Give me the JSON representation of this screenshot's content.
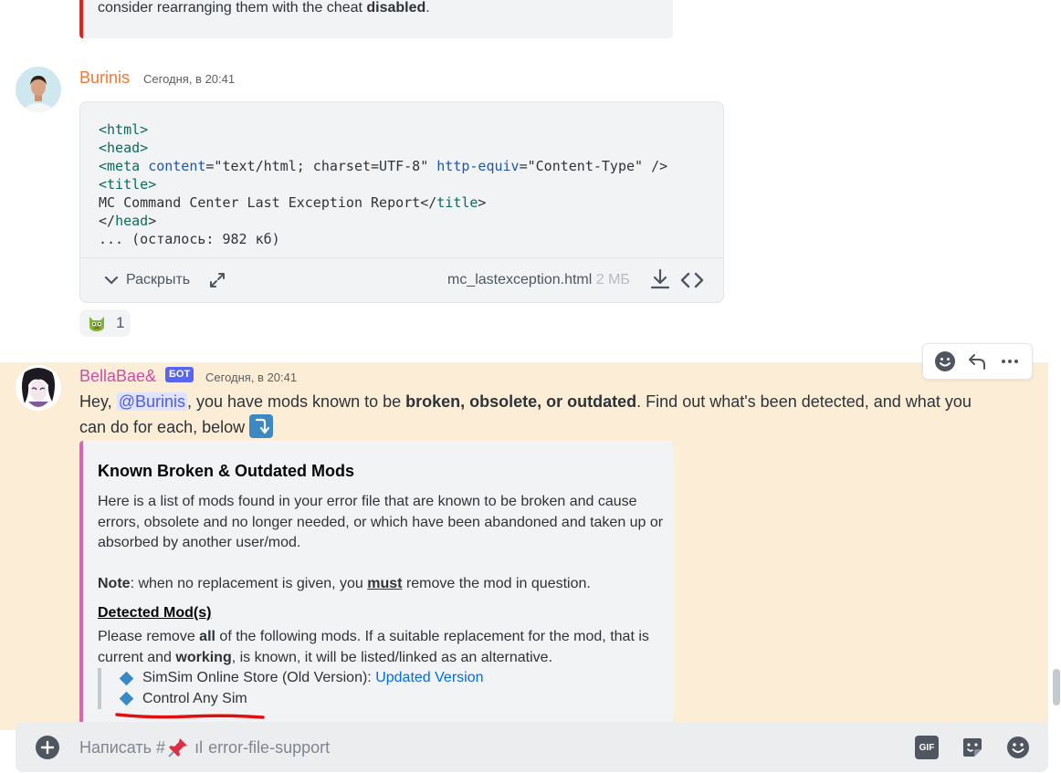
{
  "prev_message": {
    "text": "consider rearranging them with the cheat ",
    "bold": "disabled",
    "tail": "."
  },
  "msg1": {
    "author": "Burinis",
    "author_color": "#f57731",
    "timestamp": "Сегодня, в 20:41",
    "attachment": {
      "code_lines": [
        "<html>",
        "<head>",
        "<meta content=\"text/html; charset=UTF-8\" http-equiv=\"Content-Type\" />",
        "<title>",
        "MC Command Center Last Exception Report</title>",
        "</head>",
        "... (осталось: 982 кб)"
      ],
      "expand_label": "Раскрыть",
      "file_name": "mc_lastexception.html",
      "file_size": "2 МБ"
    },
    "reaction": {
      "emoji_icon": "angry-cat-emoji-icon",
      "count": "1"
    }
  },
  "msg2": {
    "author": "BellaBae&",
    "author_color": "#c74fa6",
    "badge": "БОТ",
    "timestamp": "Сегодня, в 20:41",
    "text_before_mention": "Hey, ",
    "mention": "@Burinis",
    "text_after_mention": ", you have mods known to be ",
    "bold_text": "broken, obsolete, or outdated",
    "text_end": ". Find out what's been detected, and what you can do for each, below ",
    "embed": {
      "accent_color": "#d966b5",
      "title": "Known Broken & Outdated Mods",
      "description": "Here is a list of mods found in your error file that are known to be broken and cause errors, obsolete and no longer needed, or which have been abandoned and taken up or absorbed by another user/mod.",
      "note_label": "Note",
      "note_before": ": when no replacement is given, you ",
      "note_must": "must",
      "note_after": " remove the mod in question.",
      "field_name": "Detected Mod(s)",
      "field_value_1": "Please remove ",
      "field_value_all": "all",
      "field_value_2": " of the following mods. If a suitable replacement for the mod, that is current and ",
      "field_value_working": "working",
      "field_value_3": ", is known, it will be listed/linked as an alternative.",
      "items": [
        {
          "name": "SimSim Online Store (Old Version): ",
          "link": "Updated Version"
        },
        {
          "name": "Control Any Sim",
          "link": ""
        }
      ]
    }
  },
  "composer": {
    "placeholder_prefix": "Написать #",
    "channel": "error-file-support",
    "gif_label": "GIF"
  }
}
